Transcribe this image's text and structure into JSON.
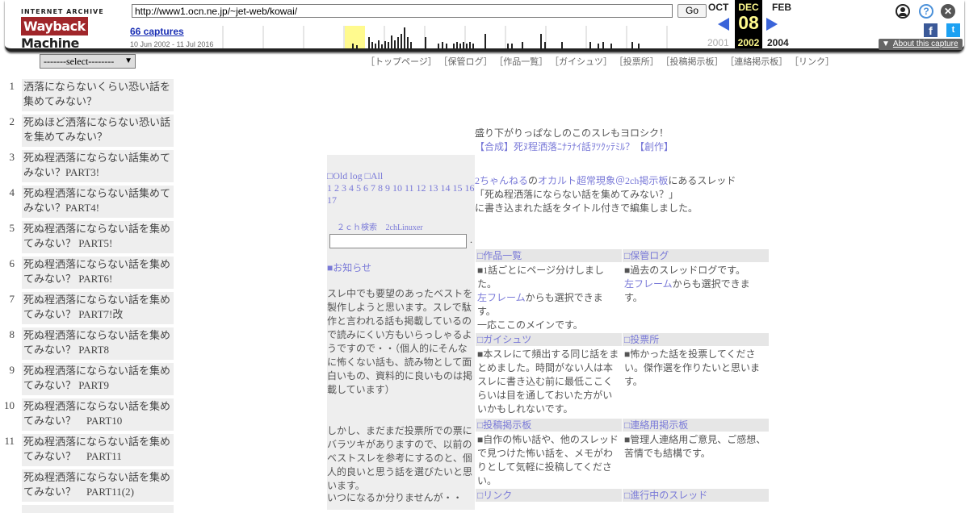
{
  "wayback": {
    "logo_top": "INTERNET ARCHIVE",
    "logo_wayback": "Wayback",
    "logo_machine": "Machine",
    "url": "http://www1.ocn.ne.jp/~jet-web/kowai/",
    "go_label": "Go",
    "captures": "66 captures",
    "range": "10 Jun 2002 - 11 Jul 2016",
    "prev_month": "OCT",
    "cur_month": "DEC",
    "next_month": "FEB",
    "cur_day": "08",
    "prev_year": "2001",
    "cur_year": "2002",
    "next_year": "2004",
    "about": "About this capture",
    "icons": [
      "user-icon",
      "help-icon",
      "close-icon",
      "facebook-icon",
      "twitter-icon"
    ]
  },
  "left": {
    "select_value": "-------select--------",
    "threads": [
      {
        "num": "1",
        "title": "洒落にならないくらい恐い話を集めてみない？"
      },
      {
        "num": "2",
        "title": "死ぬほど洒落にならない恐い話を集めてみない？"
      },
      {
        "num": "3",
        "title": "死ぬ程洒落にならない話集めてみない？PART3!"
      },
      {
        "num": "4",
        "title": "死ぬ程洒落にならない話集めてみない？PART4!"
      },
      {
        "num": "5",
        "title": "死ぬ程洒落にならない話を集めてみない？ PART5!"
      },
      {
        "num": "6",
        "title": "死ぬ程洒落にならない話を集めてみない？ PART6!"
      },
      {
        "num": "7",
        "title": "死ぬ程洒落にならない話を集めてみない？ PART7!改"
      },
      {
        "num": "8",
        "title": "死ぬ程洒落にならない話を集めてみない？ PART8"
      },
      {
        "num": "9",
        "title": "死ぬ程洒落にならない話を集めてみない？ PART9"
      },
      {
        "num": "10",
        "title": "死ぬ程洒落にならない話を集めてみない？　PART10"
      },
      {
        "num": "11",
        "title": "死ぬ程洒落にならない話を集めてみない？　PART11"
      },
      {
        "num": "",
        "title": "死ぬ程洒落にならない話を集めてみない？　PART11(2)"
      }
    ]
  },
  "nav": [
    "［トップページ］",
    "［保管ログ］",
    "［作品一覧］",
    "［ガイシュツ］",
    "［投票所］",
    "［投稿掲示板］",
    "［連絡掲示板］",
    "［リンク］"
  ],
  "mid": {
    "oldlog": "□Old log □All",
    "pages": "1 2 3 4 5 6 7 8 9 10 11 12 13 14 15 16 17",
    "search1": "２ｃｈ検索",
    "search2": "2chLinuxer",
    "dot": ".",
    "news": "■お知らせ",
    "para1": "スレ中でも要望のあったベストを製作しようと思います。スレで駄作と言われる話も掲載しているので読みにくい方もいらっしゃるようですので・・（個人的にそんなに怖くない話も、読み物として面白いもの、資料的に良いものは掲載しています）",
    "para2": "しかし、まだまだ投票所での票にバラツキがありますので、以前のベストスレを参考にするのと、個人的良いと思う話を選びたいと思います。",
    "para3": "いつになるか分りませんが・・"
  },
  "intro": {
    "line1": "盛り下がりっぱなしのこのスレもヨロシク！",
    "line2": "【合成】死ﾇ程洒落ﾆﾅﾗﾅｲ話ｦﾂｸｯﾃﾐﾙ？【創作】",
    "link_2ch": "2ちゃんねる",
    "no": "の",
    "link_occult": "オカルト超常現象＠2ch掲示板",
    "tail": "にあるスレッド",
    "line4": "「死ぬ程洒落にならない話を集めてみない？」",
    "line5": "に書き込まれた話をタイトル付きで編集しました。"
  },
  "boxes": {
    "works_hd": "□作品一覧",
    "works_b1": "■1話ごとにページ分けしました。",
    "works_link": "左フレーム",
    "works_b2": "からも選択できます。",
    "works_b3": "一応ここのメインです。",
    "log_hd": "□保管ログ",
    "log_b1": "■過去のスレッドログです。",
    "log_link": "左フレーム",
    "log_b2": "からも選択できます。",
    "gaishutsu_hd": "□ガイシュツ",
    "gaishutsu_b": "■本スレにて頻出する同じ話をまとめました。時間がない人は本スレに書き込む前に最低ここくらいは目を通しておいた方がいいかもしれないです。",
    "vote_hd": "□投票所",
    "vote_b": "■怖かった話を投票してください。傑作選を作りたいと思います。",
    "post_hd": "□投稿掲示板",
    "post_b": "■自作の怖い話や、他のスレッドで見つけた怖い話を、メモがわりとして気軽に投稿してください。",
    "contact_hd": "□連絡用掲示板",
    "contact_b": "■管理人連絡用ご意見、ご感想、苦情でも結構です。",
    "link_hd": "□リンク",
    "active_hd": "□進行中のスレッド"
  },
  "colors": {
    "link": "#7a7ad8",
    "panel": "#eeeeee",
    "wayback_highlight": "#fffa8e",
    "arrow": "#3a64d9"
  }
}
